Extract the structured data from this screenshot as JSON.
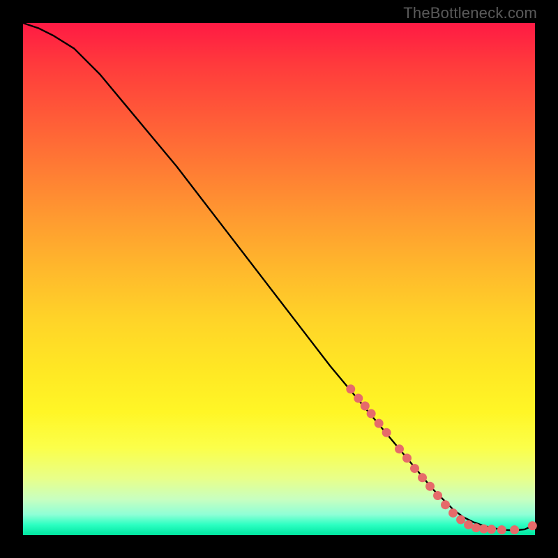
{
  "watermark": "TheBottleneck.com",
  "chart_data": {
    "type": "line",
    "title": "",
    "xlabel": "",
    "ylabel": "",
    "xlim": [
      0,
      100
    ],
    "ylim": [
      0,
      100
    ],
    "series": [
      {
        "name": "curve",
        "x": [
          0,
          3,
          6,
          10,
          15,
          20,
          25,
          30,
          35,
          40,
          45,
          50,
          55,
          60,
          65,
          70,
          75,
          80,
          82,
          84,
          86,
          88,
          90,
          92,
          94,
          96,
          98,
          100
        ],
        "y": [
          100,
          99,
          97.5,
          95,
          90,
          84,
          78,
          72,
          65.5,
          59,
          52.5,
          46,
          39.5,
          33,
          27,
          21,
          15,
          9,
          7,
          5,
          3.5,
          2.5,
          1.8,
          1.3,
          1.0,
          0.9,
          1.1,
          2.0
        ]
      }
    ],
    "markers": [
      {
        "x": 64.0,
        "y": 28.5
      },
      {
        "x": 65.5,
        "y": 26.7
      },
      {
        "x": 66.8,
        "y": 25.2
      },
      {
        "x": 68.0,
        "y": 23.7
      },
      {
        "x": 69.5,
        "y": 21.8
      },
      {
        "x": 71.0,
        "y": 20.0
      },
      {
        "x": 73.5,
        "y": 16.8
      },
      {
        "x": 75.0,
        "y": 15.0
      },
      {
        "x": 76.5,
        "y": 13.0
      },
      {
        "x": 78.0,
        "y": 11.2
      },
      {
        "x": 79.5,
        "y": 9.5
      },
      {
        "x": 81.0,
        "y": 7.7
      },
      {
        "x": 82.5,
        "y": 5.9
      },
      {
        "x": 84.0,
        "y": 4.3
      },
      {
        "x": 85.5,
        "y": 3.0
      },
      {
        "x": 87.0,
        "y": 2.0
      },
      {
        "x": 88.5,
        "y": 1.4
      },
      {
        "x": 90.0,
        "y": 1.2
      },
      {
        "x": 91.5,
        "y": 1.1
      },
      {
        "x": 93.5,
        "y": 1.0
      },
      {
        "x": 96.0,
        "y": 1.0
      },
      {
        "x": 99.5,
        "y": 1.8
      }
    ],
    "marker_color": "#e66a6a",
    "line_color": "#000000"
  }
}
